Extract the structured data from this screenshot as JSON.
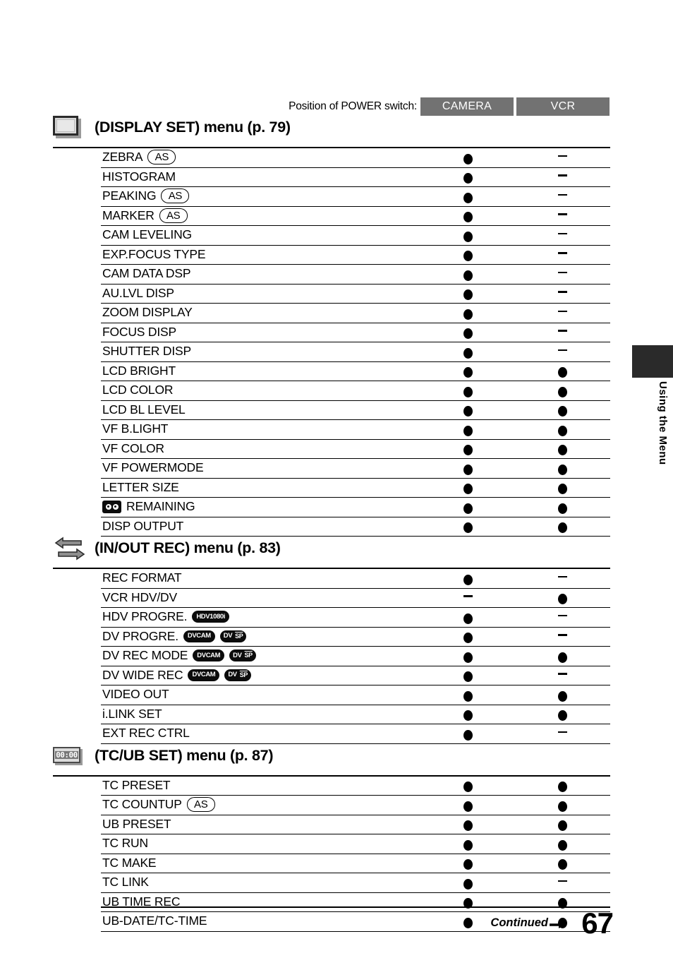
{
  "page": {
    "number": "67",
    "continued_label": "Continued",
    "side_tab_label": "Using the Menu"
  },
  "power_header": {
    "label": "Position of POWER switch:",
    "columns": [
      "CAMERA",
      "VCR"
    ],
    "column_bg": "#727272",
    "column_text_color": "#ffffff"
  },
  "sections": [
    {
      "icon": "display-monitor-icon",
      "title": "(DISPLAY SET) menu (p. 79)",
      "rows": [
        {
          "label": "ZEBRA",
          "badges": [
            "AS"
          ],
          "camera": "dot",
          "vcr": "dash"
        },
        {
          "label": "HISTOGRAM",
          "badges": [],
          "camera": "dot",
          "vcr": "dash"
        },
        {
          "label": "PEAKING",
          "badges": [
            "AS"
          ],
          "camera": "dot",
          "vcr": "dash"
        },
        {
          "label": "MARKER",
          "badges": [
            "AS"
          ],
          "camera": "dot",
          "vcr": "dash"
        },
        {
          "label": "CAM LEVELING",
          "badges": [],
          "camera": "dot",
          "vcr": "dash"
        },
        {
          "label": "EXP.FOCUS TYPE",
          "badges": [],
          "camera": "dot",
          "vcr": "dash"
        },
        {
          "label": "CAM DATA DSP",
          "badges": [],
          "camera": "dot",
          "vcr": "dash"
        },
        {
          "label": "AU.LVL DISP",
          "badges": [],
          "camera": "dot",
          "vcr": "dash"
        },
        {
          "label": "ZOOM DISPLAY",
          "badges": [],
          "camera": "dot",
          "vcr": "dash"
        },
        {
          "label": "FOCUS DISP",
          "badges": [],
          "camera": "dot",
          "vcr": "dash"
        },
        {
          "label": "SHUTTER DISP",
          "badges": [],
          "camera": "dot",
          "vcr": "dash"
        },
        {
          "label": "LCD BRIGHT",
          "badges": [],
          "camera": "dot",
          "vcr": "dot"
        },
        {
          "label": "LCD COLOR",
          "badges": [],
          "camera": "dot",
          "vcr": "dot"
        },
        {
          "label": "LCD BL LEVEL",
          "badges": [],
          "camera": "dot",
          "vcr": "dot"
        },
        {
          "label": "VF B.LIGHT",
          "badges": [],
          "camera": "dot",
          "vcr": "dot"
        },
        {
          "label": "VF COLOR",
          "badges": [],
          "camera": "dot",
          "vcr": "dot"
        },
        {
          "label": "VF POWERMODE",
          "badges": [],
          "camera": "dot",
          "vcr": "dot"
        },
        {
          "label": "LETTER SIZE",
          "badges": [],
          "camera": "dot",
          "vcr": "dot"
        },
        {
          "label": "REMAINING",
          "prefix_badges": [
            "CASSETTE"
          ],
          "badges": [],
          "camera": "dot",
          "vcr": "dot"
        },
        {
          "label": "DISP OUTPUT",
          "badges": [],
          "camera": "dot",
          "vcr": "dot"
        }
      ]
    },
    {
      "icon": "in-out-arrows-icon",
      "title": "(IN/OUT REC) menu (p. 83)",
      "rows": [
        {
          "label": "REC FORMAT",
          "badges": [],
          "camera": "dot",
          "vcr": "dash"
        },
        {
          "label": "VCR HDV/DV",
          "badges": [],
          "camera": "dash",
          "vcr": "dot"
        },
        {
          "label": "HDV PROGRE.",
          "badges": [
            "HDV1080i"
          ],
          "camera": "dot",
          "vcr": "dash"
        },
        {
          "label": "DV PROGRE.",
          "badges": [
            "DVCAM",
            "DV SP"
          ],
          "camera": "dot",
          "vcr": "dash"
        },
        {
          "label": "DV REC MODE",
          "badges": [
            "DVCAM",
            "DV SP"
          ],
          "camera": "dot",
          "vcr": "dot"
        },
        {
          "label": "DV WIDE REC",
          "badges": [
            "DVCAM",
            "DV SP"
          ],
          "camera": "dot",
          "vcr": "dash"
        },
        {
          "label": "VIDEO OUT",
          "badges": [],
          "camera": "dot",
          "vcr": "dot"
        },
        {
          "label": "i.LINK SET",
          "badges": [],
          "camera": "dot",
          "vcr": "dot"
        },
        {
          "label": "EXT REC CTRL",
          "badges": [],
          "camera": "dot",
          "vcr": "dash"
        }
      ]
    },
    {
      "icon": "timecode-icon",
      "title": "(TC/UB SET) menu (p. 87)",
      "rows": [
        {
          "label": "TC PRESET",
          "badges": [],
          "camera": "dot",
          "vcr": "dot"
        },
        {
          "label": "TC COUNTUP",
          "badges": [
            "AS"
          ],
          "camera": "dot",
          "vcr": "dot"
        },
        {
          "label": "UB PRESET",
          "badges": [],
          "camera": "dot",
          "vcr": "dot"
        },
        {
          "label": "TC RUN",
          "badges": [],
          "camera": "dot",
          "vcr": "dot"
        },
        {
          "label": "TC MAKE",
          "badges": [],
          "camera": "dot",
          "vcr": "dot"
        },
        {
          "label": "TC LINK",
          "badges": [],
          "camera": "dot",
          "vcr": "dash"
        },
        {
          "label": "UB TIME REC",
          "badges": [],
          "camera": "dot",
          "vcr": "dot"
        },
        {
          "label": "UB-DATE/TC-TIME",
          "badges": [],
          "camera": "dot",
          "vcr": "dot"
        }
      ]
    }
  ],
  "icons": {
    "timecode_text": "00:00"
  }
}
